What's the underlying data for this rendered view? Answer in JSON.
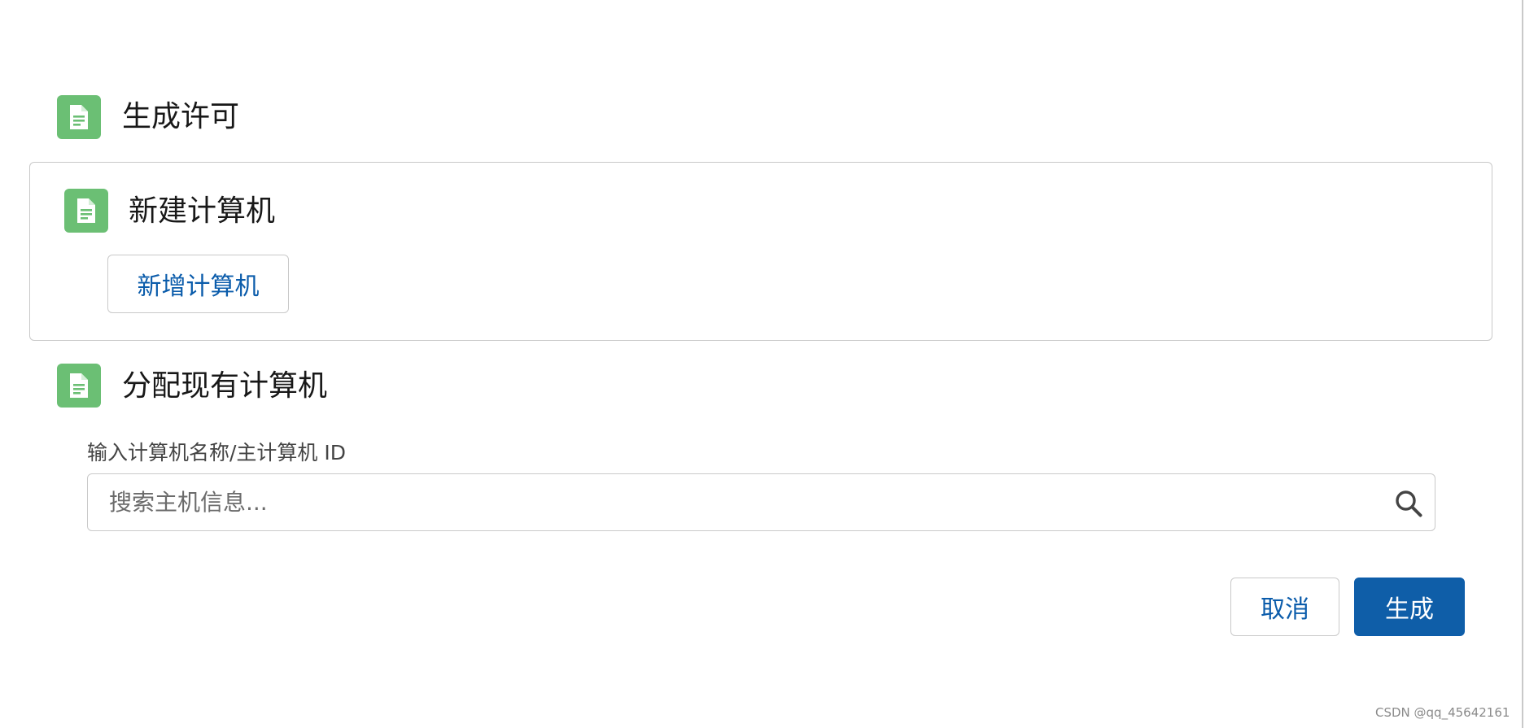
{
  "header": {
    "title": "生成许可",
    "icon": "document-icon"
  },
  "new_computer": {
    "title": "新建计算机",
    "icon": "document-icon",
    "add_button_label": "新增计算机"
  },
  "assign_existing": {
    "title": "分配现有计算机",
    "icon": "document-icon",
    "field_label": "输入计算机名称/主计算机 ID",
    "search_placeholder": "搜索主机信息...",
    "search_value": ""
  },
  "footer": {
    "cancel_label": "取消",
    "generate_label": "生成"
  },
  "watermark": "CSDN @qq_45642161",
  "colors": {
    "icon_green": "#6bbf74",
    "primary_blue": "#0f5ea8",
    "link_blue": "#0b5cab",
    "border_gray": "#c9c9c9"
  }
}
